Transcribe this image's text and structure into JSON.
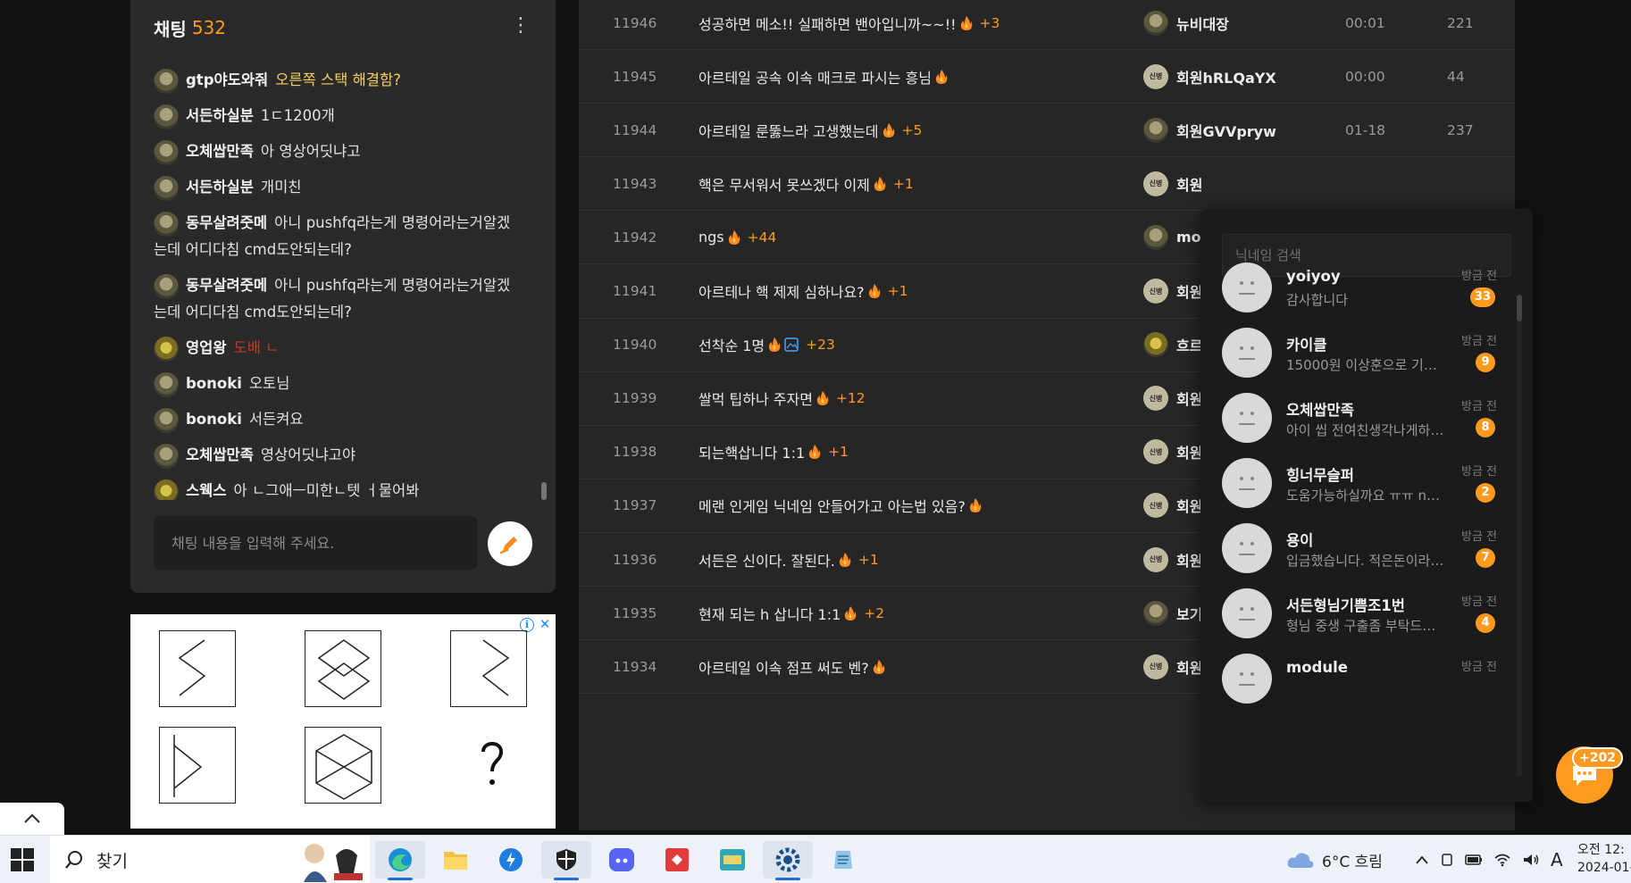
{
  "chat": {
    "title": "채팅",
    "count": "532",
    "input_placeholder": "채팅 내용을 입력해 주세요.",
    "messages": [
      {
        "nick": "gtp야도와줘",
        "text": "오른쪽 스택 해결함?"
      },
      {
        "nick": "서든하실분",
        "text": "1ㄷ1200개"
      },
      {
        "nick": "오체쌉만족",
        "text": "아 영상어딧냐고"
      },
      {
        "nick": "서든하실분",
        "text": "개미친"
      },
      {
        "nick": "동무살려줏메",
        "text": "아니 pushfq라는게 명령어라는거알겠는데 어디다침 cmd도안되는데?"
      },
      {
        "nick": "동무살려줏메",
        "text": "아니 pushfq라는게 명령어라는거알겠는데 어디다침 cmd도안되는데?"
      },
      {
        "nick": "영업왕",
        "text": "도배 ㄴ"
      },
      {
        "nick": "bonoki",
        "text": "오토님"
      },
      {
        "nick": "bonoki",
        "text": "서든켜요"
      },
      {
        "nick": "오체쌉만족",
        "text": "영상어딧냐고야"
      },
      {
        "nick": "스웩스",
        "text": "아 ㄴ그애ㅡ미한ㄴ텟 ㅓ물어봐"
      }
    ]
  },
  "board": {
    "rows": [
      {
        "no": "11946",
        "title": "성공하면 메소!! 실패하면 밴아입니까~~!!",
        "plus": "+3",
        "author": "뉴비대장",
        "time": "00:01",
        "views": "221"
      },
      {
        "no": "11945",
        "title": "아르테일 공속 이속 매크로 파시는 흥님",
        "plus": "",
        "author": "회원hRLQaYX",
        "time": "00:00",
        "views": "44"
      },
      {
        "no": "11944",
        "title": "아르테일 룬뚫느라 고생했는데",
        "plus": "+5",
        "author": "회원GVVpryw",
        "time": "01-18",
        "views": "237"
      },
      {
        "no": "11943",
        "title": "핵은 무서워서 못쓰겠다 이제",
        "plus": "+1",
        "author": "회원",
        "time": "",
        "views": ""
      },
      {
        "no": "11942",
        "title": "ngs",
        "plus": "+44",
        "author": "mo",
        "time": "",
        "views": ""
      },
      {
        "no": "11941",
        "title": "아르테나 핵 제제 심하나요?",
        "plus": "+1",
        "author": "회원",
        "time": "",
        "views": ""
      },
      {
        "no": "11940",
        "title": "선착순 1명",
        "plus": "+23",
        "author": "흐르",
        "time": "",
        "views": ""
      },
      {
        "no": "11939",
        "title": "쌀먹 팁하나 주자면",
        "plus": "+12",
        "author": "회원",
        "time": "",
        "views": ""
      },
      {
        "no": "11938",
        "title": "되는핵삽니다 1:1",
        "plus": "+1",
        "author": "회원",
        "time": "",
        "views": ""
      },
      {
        "no": "11937",
        "title": "메랜 인게임 닉네임 안들어가고 아는법 있음?",
        "plus": "",
        "author": "회원",
        "time": "",
        "views": ""
      },
      {
        "no": "11936",
        "title": "서든은 신이다. 잘된다.",
        "plus": "+1",
        "author": "회원",
        "time": "",
        "views": ""
      },
      {
        "no": "11935",
        "title": "현재 되는 h 삽니다 1:1",
        "plus": "+2",
        "author": "보기",
        "time": "",
        "views": ""
      },
      {
        "no": "11934",
        "title": "아르테일 이속 점프 써도 벤?",
        "plus": "",
        "author": "회원",
        "time": "",
        "views": ""
      }
    ],
    "rookie_badge": "신병"
  },
  "dm": {
    "search_placeholder": "닉네임 검색",
    "items": [
      {
        "name": "yoiyoy",
        "preview": "감사합니다",
        "ago": "방금 전",
        "badge": "33"
      },
      {
        "name": "카이클",
        "preview": "15000원 이상훈으로 기…",
        "ago": "방금 전",
        "badge": "9"
      },
      {
        "name": "오체쌉만족",
        "preview": "아이 씹 전여친생각나게하…",
        "ago": "방금 전",
        "badge": "8"
      },
      {
        "name": "힝너무슬퍼",
        "preview": "도움가능하실까요 ㅠㅠ n…",
        "ago": "방금 전",
        "badge": "2"
      },
      {
        "name": "용이",
        "preview": "입금했습니다. 적은돈이라…",
        "ago": "방금 전",
        "badge": "7"
      },
      {
        "name": "서든형님기쁨조1번",
        "preview": "형님 중생 구출좀 부탁드…",
        "ago": "방금 전",
        "badge": "4"
      },
      {
        "name": "module",
        "preview": "",
        "ago": "방금 전",
        "badge": ""
      }
    ],
    "fab_count": "+202"
  },
  "taskbar": {
    "search_label": "찾기",
    "weather": "6°C 흐림",
    "ime": "A",
    "clock_time": "오전 12:",
    "clock_date": "2024-01-"
  },
  "colors": {
    "accent": "#ff9a1f",
    "bg": "#121212",
    "panel": "#2a2a2a"
  }
}
